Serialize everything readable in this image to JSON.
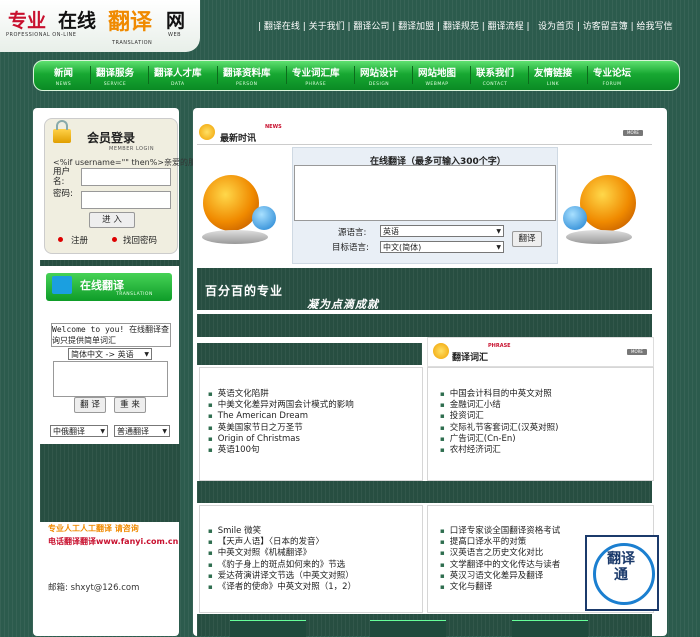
{
  "logo": {
    "zh1": "专业",
    "zh2": "在线",
    "zh3": "翻译",
    "zh4": "网",
    "en1": "PROFESSIONAL ON-LINE",
    "en2": "TRANSLATION",
    "en3": "WEB"
  },
  "topnav": "| 翻译在线 | 关于我们 | 翻译公司 | 翻译加盟 | 翻译规范 | 翻译流程 |",
  "toplinks": "设为首页 | 访客留言簿 | 给我写信",
  "nav": [
    {
      "label": "新闻",
      "sub": "NEWS"
    },
    {
      "label": "翻译服务",
      "sub": "SERVICE"
    },
    {
      "label": "翻译人才库",
      "sub": "DATA"
    },
    {
      "label": "翻译资料库",
      "sub": "PERSON"
    },
    {
      "label": "专业词汇库",
      "sub": "PHRASE"
    },
    {
      "label": "网站设计",
      "sub": "DESIGN"
    },
    {
      "label": "网站地图",
      "sub": "WEBMAP"
    },
    {
      "label": "联系我们",
      "sub": "CONTACT"
    },
    {
      "label": "友情链接",
      "sub": "LINK"
    },
    {
      "label": "专业论坛",
      "sub": "FORUM"
    }
  ],
  "login": {
    "title": "会员登录",
    "subtitle": "MEMBER LOGIN",
    "overlay": "<%if username=\"\" then%>亲爱的朋友",
    "user_label": "用户名:",
    "pass_label": "密码:",
    "submit": "进 入",
    "register": "注册",
    "find_pw": "找回密码"
  },
  "translate_side": {
    "title": "在线翻译",
    "subtitle": "TRANSLATION",
    "welcome": "Welcome to you! 在线翻译查询只提供简单词汇",
    "direction": "简体中文 -> 英语",
    "btn_translate": "翻 译",
    "btn_reset": "重 来",
    "engine": "中俄翻译",
    "mode": "普通翻译"
  },
  "contact": {
    "line1": "专业人工人工翻译  请咨询",
    "line2": "电话翻译翻译www.fanyi.com.cn",
    "email": "邮箱: shxyt@126.com"
  },
  "news": {
    "title": "最新时讯",
    "badge": "NEWS",
    "more": "MORE"
  },
  "online_translate": {
    "title": "在线翻译（最多可输入300个字）",
    "src_label": "源语言:",
    "src_value": "英语",
    "tgt_label": "目标语言:",
    "tgt_value": "中文(简体)",
    "button": "翻译"
  },
  "banner": {
    "line1": "百分百的专业",
    "line2": "凝为点滴成就"
  },
  "phrase": {
    "title": "翻译词汇",
    "badge": "PHRASE",
    "more": "MORE"
  },
  "list1": [
    "英语文化陷阱",
    "中美文化差异对两国会计模式的影响",
    "The American Dream",
    "英美国家节日之万圣节",
    "Origin of Christmas",
    "英语100句"
  ],
  "list2": [
    "中国会计科目的中英文对照",
    "金融词汇小结",
    "投资词汇",
    "交际礼节客套词汇(汉英对照)",
    "广告词汇(Cn-En)",
    "农村经济词汇"
  ],
  "list3": [
    "Smile 微笑",
    "【天声人语】〈日本的发音〉",
    "中英文对照《机械翻译》",
    "《豹子身上的斑点如何来的》节选",
    "爱达荷演讲译文节选（中英文对照）",
    "《译者的使命》中英文对照（1，2）"
  ],
  "list4": [
    "口译专家谈全国翻译资格考试",
    "提高口译水平的对策",
    "汉英语言之历史文化对比",
    "文学翻译中的文化传达与读者",
    "英汉习语文化差异及翻译",
    "文化与翻译"
  ],
  "seal": "翻译通",
  "colors": {
    "brand_green": "#17a832",
    "dark_green": "#2c5b4d",
    "logo_red": "#c8102e",
    "logo_orange": "#f08a00"
  }
}
